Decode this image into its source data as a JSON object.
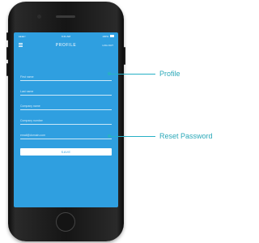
{
  "status_bar": {
    "carrier": "●●●●○",
    "time": "9:41 AM",
    "battery": "100%"
  },
  "nav": {
    "title": "PROFILE",
    "right_label": "LOG OUT"
  },
  "form": {
    "fields": [
      {
        "label": "First name"
      },
      {
        "label": "Last name"
      },
      {
        "label": "Company name"
      },
      {
        "label": "Company number"
      },
      {
        "label": "email@domain.com"
      }
    ],
    "update_password_label": "Update Password",
    "save_label": "SAVE"
  },
  "callouts": {
    "profile": "Profile",
    "reset_password": "Reset Password"
  },
  "colors": {
    "screen_blue": "#2f9fe0",
    "callout_teal": "#27b0c6"
  }
}
